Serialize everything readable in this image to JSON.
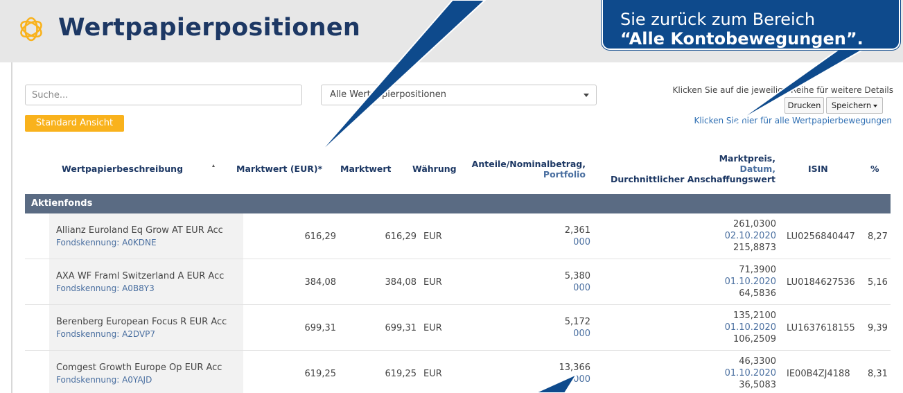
{
  "header": {
    "title": "Wertpapierpositionen"
  },
  "toolbar": {
    "search_placeholder": "Suche...",
    "filter_value": "Alle Wertpapierpositionen",
    "standard_view_label": "Standard Ansicht",
    "click_hint": "Klicken Sie auf die jeweilige Reihe für weitere Details",
    "print_label": "Drucken",
    "save_label": "Speichern",
    "all_movements_link": "Klicken Sie hier für alle Wertpapierbewegungen"
  },
  "table": {
    "headers": {
      "description": "Wertpapierbeschreibung",
      "market_value_eur": "Marktwert (EUR)*",
      "market_value": "Marktwert",
      "currency": "Währung",
      "units_line1": "Anteile/Nominalbetrag,",
      "units_line2": "Portfolio",
      "price_line1": "Marktpreis,",
      "price_line2": "Datum,",
      "price_line3": "Durchnittlicher Anschaffungswert",
      "isin": "ISIN",
      "percent": "%"
    },
    "group": "Aktienfonds",
    "rows": [
      {
        "name": "Allianz Euroland Eq Grow AT EUR Acc",
        "fk": "Fondskennung: A0KDNE",
        "mv_eur": "616,29",
        "mv": "616,29",
        "cur": "EUR",
        "units": "2,361",
        "portfolio": "000",
        "price": "261,0300",
        "date": "02.10.2020",
        "avg": "215,8873",
        "isin": "LU0256840447",
        "pct": "8,27"
      },
      {
        "name": "AXA WF Framl Switzerland A EUR Acc",
        "fk": "Fondskennung: A0B8Y3",
        "mv_eur": "384,08",
        "mv": "384,08",
        "cur": "EUR",
        "units": "5,380",
        "portfolio": "000",
        "price": "71,3900",
        "date": "01.10.2020",
        "avg": "64,5836",
        "isin": "LU0184627536",
        "pct": "5,16"
      },
      {
        "name": "Berenberg European Focus R EUR Acc",
        "fk": "Fondskennung: A2DVP7",
        "mv_eur": "699,31",
        "mv": "699,31",
        "cur": "EUR",
        "units": "5,172",
        "portfolio": "000",
        "price": "135,2100",
        "date": "01.10.2020",
        "avg": "106,2509",
        "isin": "LU1637618155",
        "pct": "9,39"
      },
      {
        "name": "Comgest Growth Europe Op EUR Acc",
        "fk": "Fondskennung: A0YAJD",
        "mv_eur": "619,25",
        "mv": "619,25",
        "cur": "EUR",
        "units": "13,366",
        "portfolio": "000",
        "price": "46,3300",
        "date": "01.10.2020",
        "avg": "36,5083",
        "isin": "IE00B4ZJ4188",
        "pct": "8,31"
      }
    ]
  },
  "callout": {
    "line1": "Sie zurück zum Bereich",
    "line2": "“Alle Kontobewegungen”."
  },
  "colors": {
    "title": "#1d3864",
    "accent": "#f9b21c",
    "group_header": "#5a6b83",
    "link": "#2f6fb3",
    "callout": "#0e4a8c"
  },
  "icons": [
    "logo-icon",
    "sort-ascending-icon",
    "dropdown-caret-icon"
  ]
}
